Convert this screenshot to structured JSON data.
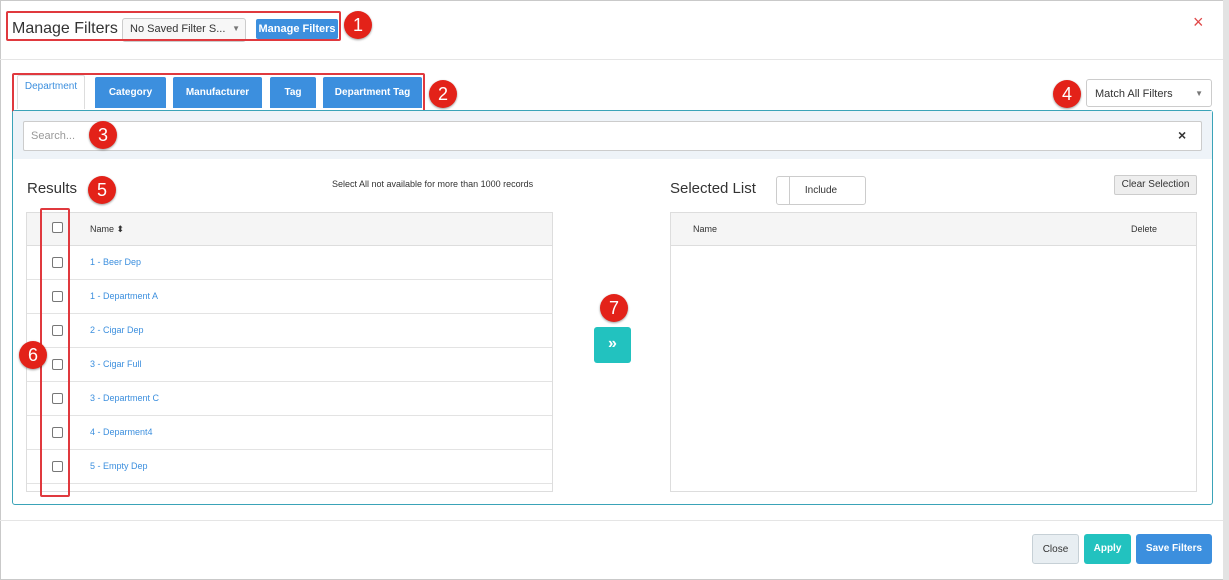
{
  "header": {
    "title": "Manage Filters",
    "saved_filter_value": "No Saved Filter S...",
    "manage_button": "Manage Filters",
    "close_icon": "×"
  },
  "tabs": [
    {
      "label": "Department",
      "active": true
    },
    {
      "label": "Category",
      "active": false
    },
    {
      "label": "Manufacturer",
      "active": false
    },
    {
      "label": "Tag",
      "active": false
    },
    {
      "label": "Department Tag",
      "active": false
    }
  ],
  "match_select": {
    "value": "Match All Filters"
  },
  "search": {
    "placeholder": "Search...",
    "clear_icon": "×"
  },
  "results": {
    "title": "Results",
    "note": "Select All not available for more than 1000 records",
    "column_name": "Name",
    "sort_icon": "⬍",
    "rows": [
      "1 - Beer Dep",
      "1 - Department A",
      "2 - Cigar Dep",
      "3 - Cigar Full",
      "3 - Department C",
      "4 - Deparment4",
      "5 - Empty Dep"
    ]
  },
  "move_button": "»",
  "selected": {
    "title": "Selected List",
    "include_label": "Include",
    "clear_label": "Clear Selection",
    "column_name": "Name",
    "column_delete": "Delete"
  },
  "footer": {
    "close": "Close",
    "apply": "Apply",
    "save": "Save Filters"
  },
  "markers": [
    "1",
    "2",
    "3",
    "4",
    "5",
    "6",
    "7"
  ],
  "colors": {
    "primary": "#3c8fde",
    "teal": "#22c2bf",
    "marker_red": "#e32219",
    "annotation_border": "#e0393e",
    "panel_border": "#3aa3b8"
  }
}
